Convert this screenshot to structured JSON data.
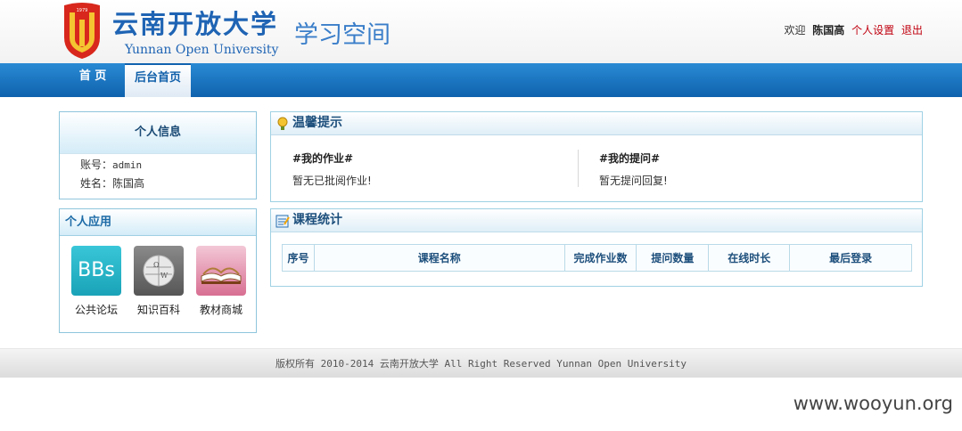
{
  "header": {
    "logo_cn": "云南开放大学",
    "logo_en": "Yunnan Open University",
    "logo_year": "1979",
    "subtitle": "学习空间",
    "welcome": "欢迎",
    "username": "陈国高",
    "settings_link": "个人设置",
    "logout_link": "退出"
  },
  "nav": {
    "home": "首 页",
    "admin_home": "后台首页"
  },
  "personal_info": {
    "title": "个人信息",
    "account_label": "账号：",
    "account_value": "admin",
    "name_label": "姓名：",
    "name_value": "陈国高"
  },
  "apps": {
    "title": "个人应用",
    "items": [
      {
        "label": "公共论坛",
        "tile_text": "BBs",
        "icon": "bbs-icon"
      },
      {
        "label": "知识百科",
        "icon": "wiki-globe-icon"
      },
      {
        "label": "教材商城",
        "icon": "book-icon"
      }
    ]
  },
  "tips": {
    "title": "温馨提示",
    "homework_title": "#我的作业#",
    "homework_desc": "暂无已批阅作业!",
    "questions_title": "#我的提问#",
    "questions_desc": "暂无提问回复!"
  },
  "course_stats": {
    "title": "课程统计",
    "columns": [
      "序号",
      "课程名称",
      "完成作业数",
      "提问数量",
      "在线时长",
      "最后登录"
    ]
  },
  "footer": {
    "text": "版权所有 2010-2014  云南开放大学  All Right Reserved Yunnan Open University"
  },
  "watermark": "www.wooyun.org",
  "colors": {
    "nav_blue": "#1a75c2",
    "brand_blue": "#1f64b4",
    "link_red": "#c0000f",
    "panel_border": "#8fc6dc"
  }
}
